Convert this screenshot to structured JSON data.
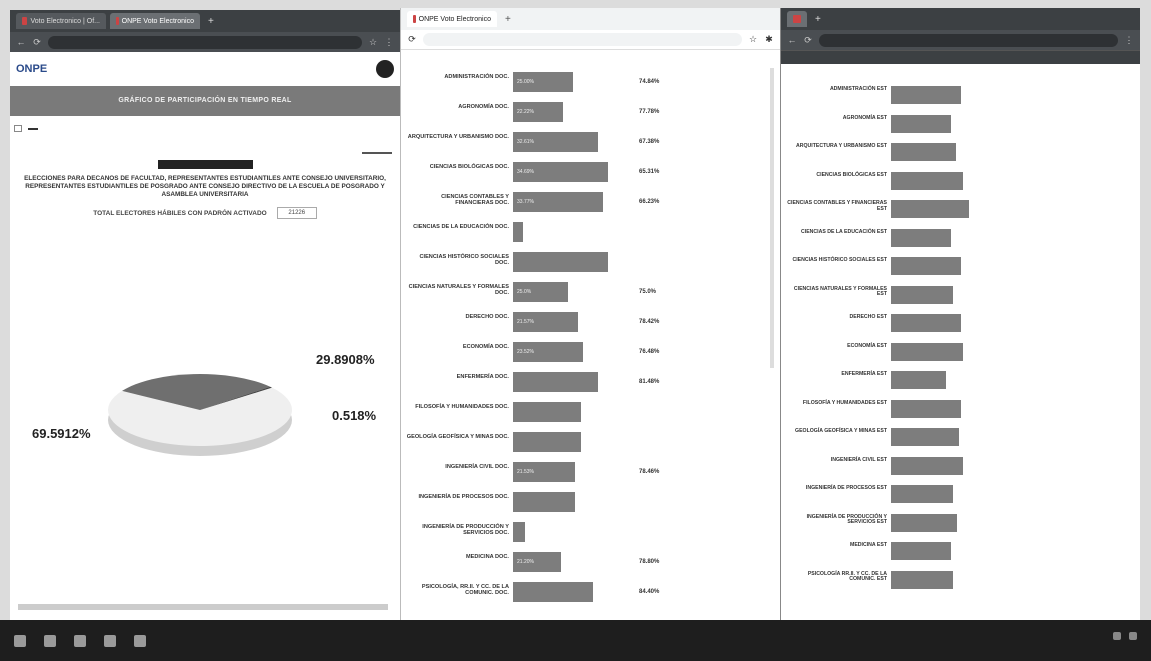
{
  "browser": {
    "win1_tabs": [
      "Voto Electronico | Of...",
      "ONPE Voto Electronico"
    ],
    "win2_tab": "ONPE Voto Electronico"
  },
  "onpe": {
    "logo": "ONPE",
    "banner": "GRÁFICO DE PARTICIPACIÓN EN TIEMPO REAL",
    "election_title": "ELECCIONES PARA DECANOS DE FACULTAD, REPRESENTANTES ESTUDIANTILES ANTE CONSEJO UNIVERSITARIO, REPRESENTANTES ESTUDIANTILES DE POSGRADO ANTE CONSEJO DIRECTIVO DE LA ESCUELA DE POSGRADO Y ASAMBLEA UNIVERSITARIA",
    "total_label": "TOTAL ELECTORES HÁBILES CON PADRÓN ACTIVADO",
    "total_value": "21226",
    "pie_labels": {
      "a": "29.8908%",
      "b": "0.518%",
      "c": "69.5912%"
    }
  },
  "chart_data": [
    {
      "type": "pie",
      "values": [
        69.5912,
        29.8908,
        0.518
      ],
      "colors": [
        "#efefef",
        "#6f6f6f",
        "#444444"
      ]
    },
    {
      "type": "bar",
      "categories": [
        "ADMINISTRACIÓN DOC.",
        "AGRONOMÍA DOC.",
        "ARQUITECTURA Y URBANISMO DOC.",
        "CIENCIAS BIOLÓGICAS DOC.",
        "CIENCIAS CONTABLES Y FINANCIERAS DOC.",
        "CIENCIAS DE LA EDUCACIÓN DOC.",
        "CIENCIAS HISTÓRICO SOCIALES DOC.",
        "CIENCIAS NATURALES Y FORMALES DOC.",
        "DERECHO DOC.",
        "ECONOMÍA DOC.",
        "ENFERMERÍA DOC.",
        "FILOSOFÍA Y HUMANIDADES DOC.",
        "GEOLOGÍA GEOFÍSICA Y MINAS DOC.",
        "INGENIERÍA CIVIL DOC.",
        "INGENIERÍA DE PROCESOS DOC.",
        "INGENIERÍA DE PRODUCCIÓN Y SERVICIOS DOC.",
        "MEDICINA DOC.",
        "PSICOLOGÍA, RR.II. Y CC. DE LA COMUNIC. DOC."
      ],
      "value_labels": [
        "74.84%",
        "77.78%",
        "67.38%",
        "65.31%",
        "66.23%",
        "",
        "",
        "75.0%",
        "78.42%",
        "76.48%",
        "81.48%",
        "",
        "",
        "78.46%",
        "",
        "",
        "78.80%",
        "84.40%"
      ]
    },
    {
      "type": "bar",
      "categories": [
        "ADMINISTRACIÓN EST",
        "AGRONOMÍA EST",
        "ARQUITECTURA Y URBANISMO EST",
        "CIENCIAS BIOLÓGICAS EST",
        "CIENCIAS CONTABLES Y FINANCIERAS EST",
        "CIENCIAS DE LA EDUCACIÓN EST",
        "CIENCIAS HISTÓRICO SOCIALES EST",
        "CIENCIAS NATURALES Y FORMALES EST",
        "DERECHO EST",
        "ECONOMÍA EST",
        "ENFERMERÍA EST",
        "FILOSOFÍA Y HUMANIDADES EST",
        "GEOLOGÍA GEOFÍSICA Y MINAS EST",
        "INGENIERÍA CIVIL EST",
        "INGENIERÍA DE PROCESOS EST",
        "INGENIERÍA DE PRODUCCIÓN Y SERVICIOS EST",
        "MEDICINA EST",
        "PSICOLOGÍA RR.II. Y CC. DE LA COMUNIC. EST"
      ]
    }
  ],
  "win2_bars": [
    {
      "label": "ADMINISTRACIÓN DOC.",
      "inner": "25.00%",
      "w": 60,
      "pct": "74.84%"
    },
    {
      "label": "AGRONOMÍA DOC.",
      "inner": "22.22%",
      "w": 50,
      "pct": "77.78%"
    },
    {
      "label": "ARQUITECTURA Y URBANISMO DOC.",
      "inner": "32.61%",
      "w": 85,
      "pct": "67.38%"
    },
    {
      "label": "CIENCIAS BIOLÓGICAS DOC.",
      "inner": "34.69%",
      "w": 95,
      "pct": "65.31%"
    },
    {
      "label": "CIENCIAS CONTABLES Y FINANCIERAS DOC.",
      "inner": "33.77%",
      "w": 90,
      "pct": "66.23%"
    },
    {
      "label": "CIENCIAS DE LA EDUCACIÓN DOC.",
      "inner": "",
      "w": 10,
      "pct": ""
    },
    {
      "label": "CIENCIAS HISTÓRICO SOCIALES DOC.",
      "inner": "",
      "w": 95,
      "pct": ""
    },
    {
      "label": "CIENCIAS NATURALES Y FORMALES DOC.",
      "inner": "25.0%",
      "w": 55,
      "pct": "75.0%"
    },
    {
      "label": "DERECHO DOC.",
      "inner": "21.57%",
      "w": 65,
      "pct": "78.42%"
    },
    {
      "label": "ECONOMÍA DOC.",
      "inner": "23.52%",
      "w": 70,
      "pct": "76.48%"
    },
    {
      "label": "ENFERMERÍA DOC.",
      "inner": "",
      "w": 85,
      "pct": "81.48%"
    },
    {
      "label": "FILOSOFÍA Y HUMANIDADES DOC.",
      "inner": "",
      "w": 68,
      "pct": ""
    },
    {
      "label": "GEOLOGÍA GEOFÍSICA Y MINAS DOC.",
      "inner": "",
      "w": 68,
      "pct": ""
    },
    {
      "label": "INGENIERÍA CIVIL DOC.",
      "inner": "21.53%",
      "w": 62,
      "pct": "78.46%"
    },
    {
      "label": "INGENIERÍA DE PROCESOS DOC.",
      "inner": "",
      "w": 62,
      "pct": ""
    },
    {
      "label": "INGENIERÍA DE PRODUCCIÓN Y SERVICIOS DOC.",
      "inner": "",
      "w": 12,
      "pct": ""
    },
    {
      "label": "MEDICINA DOC.",
      "inner": "21.20%",
      "w": 48,
      "pct": "78.80%"
    },
    {
      "label": "PSICOLOGÍA, RR.II. Y CC. DE LA COMUNIC. DOC.",
      "inner": "",
      "w": 80,
      "pct": "84.40%"
    }
  ],
  "win3_bars": [
    {
      "label": "ADMINISTRACIÓN EST",
      "w": 70
    },
    {
      "label": "AGRONOMÍA EST",
      "w": 60
    },
    {
      "label": "ARQUITECTURA Y URBANISMO EST",
      "w": 65
    },
    {
      "label": "CIENCIAS BIOLÓGICAS EST",
      "w": 72
    },
    {
      "label": "CIENCIAS CONTABLES Y FINANCIERAS EST",
      "w": 78
    },
    {
      "label": "CIENCIAS DE LA EDUCACIÓN EST",
      "w": 60
    },
    {
      "label": "CIENCIAS HISTÓRICO SOCIALES EST",
      "w": 70
    },
    {
      "label": "CIENCIAS NATURALES Y FORMALES EST",
      "w": 62
    },
    {
      "label": "DERECHO EST",
      "w": 70
    },
    {
      "label": "ECONOMÍA EST",
      "w": 72
    },
    {
      "label": "ENFERMERÍA EST",
      "w": 55
    },
    {
      "label": "FILOSOFÍA Y HUMANIDADES EST",
      "w": 70
    },
    {
      "label": "GEOLOGÍA GEOFÍSICA Y MINAS EST",
      "w": 68
    },
    {
      "label": "INGENIERÍA CIVIL EST",
      "w": 72
    },
    {
      "label": "INGENIERÍA DE PROCESOS EST",
      "w": 62
    },
    {
      "label": "INGENIERÍA DE PRODUCCIÓN Y SERVICIOS EST",
      "w": 66
    },
    {
      "label": "MEDICINA EST",
      "w": 60
    },
    {
      "label": "PSICOLOGÍA RR.II. Y CC. DE LA COMUNIC. EST",
      "w": 62
    }
  ],
  "icons": [
    "windows-start-icon",
    "search-icon",
    "taskview-icon",
    "browser-icon",
    "folder-icon"
  ]
}
